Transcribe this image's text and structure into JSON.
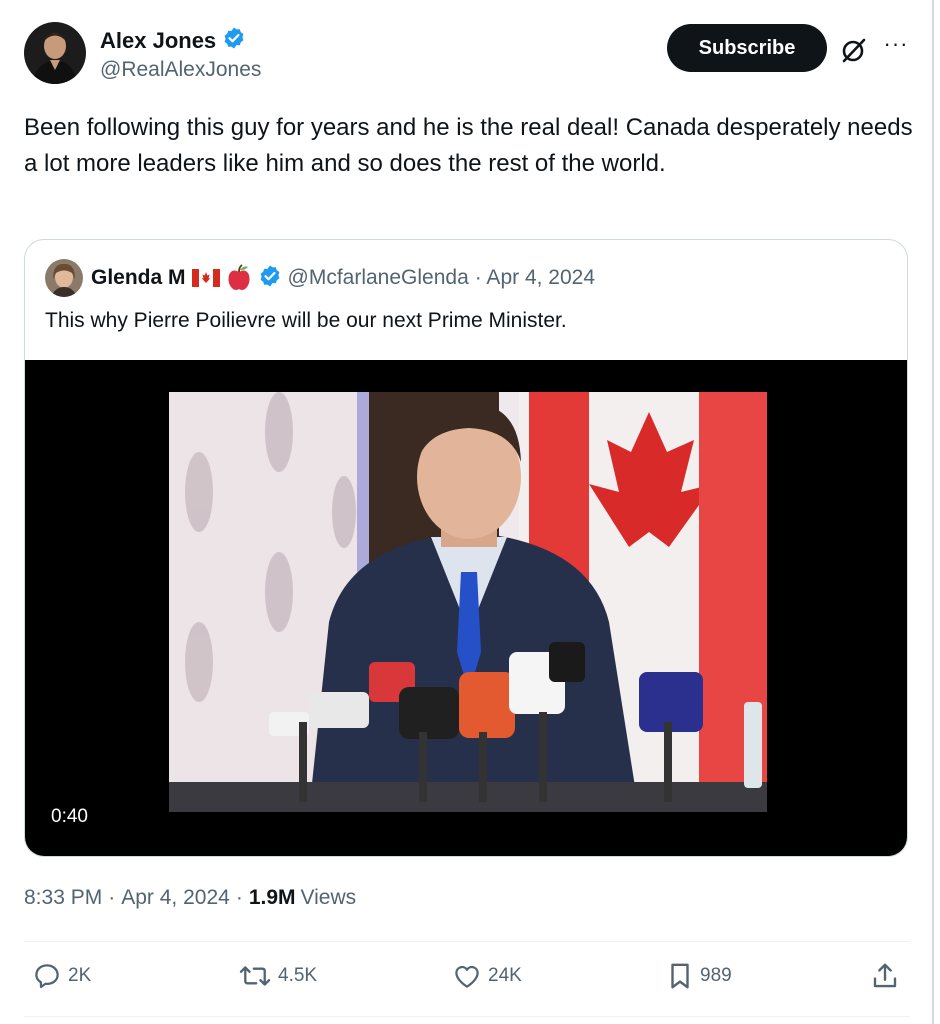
{
  "author": {
    "name": "Alex Jones",
    "handle": "@RealAlexJones",
    "verified_icon": "verified-badge-icon"
  },
  "header": {
    "subscribe_label": "Subscribe",
    "grok_icon": "grok-icon",
    "more_label": "···"
  },
  "tweet": {
    "text": "Been following this guy for years and he is the real deal! Canada desperately needs a lot more leaders like him and so does the rest of the world."
  },
  "quote": {
    "name": "Glenda M",
    "handle": "@McfarlaneGlenda",
    "date": "· Apr 4, 2024",
    "text": "This why Pierre Poilievre will be our next Prime Minister.",
    "video_duration": "0:40"
  },
  "meta": {
    "time": "8:33 PM",
    "separator": "·",
    "date": "Apr 4, 2024",
    "views_count": "1.9M",
    "views_label": "Views"
  },
  "actions": {
    "replies": "2K",
    "reposts": "4.5K",
    "likes": "24K",
    "bookmarks": "989"
  },
  "colors": {
    "accent": "#1d9bf0",
    "text": "#0f1419",
    "muted": "#536471",
    "border": "#cfd9de"
  }
}
